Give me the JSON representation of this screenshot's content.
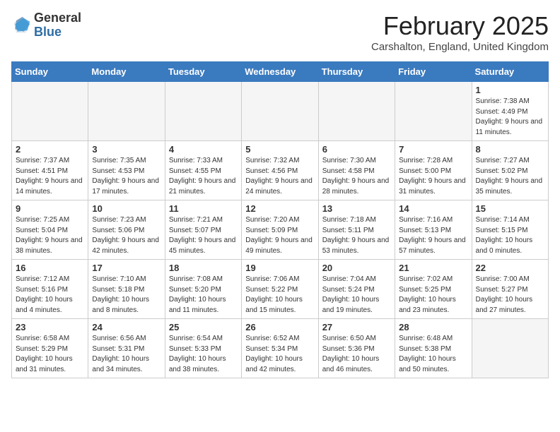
{
  "header": {
    "logo_general": "General",
    "logo_blue": "Blue",
    "month": "February 2025",
    "location": "Carshalton, England, United Kingdom"
  },
  "days_of_week": [
    "Sunday",
    "Monday",
    "Tuesday",
    "Wednesday",
    "Thursday",
    "Friday",
    "Saturday"
  ],
  "weeks": [
    [
      {
        "num": "",
        "info": ""
      },
      {
        "num": "",
        "info": ""
      },
      {
        "num": "",
        "info": ""
      },
      {
        "num": "",
        "info": ""
      },
      {
        "num": "",
        "info": ""
      },
      {
        "num": "",
        "info": ""
      },
      {
        "num": "1",
        "info": "Sunrise: 7:38 AM\nSunset: 4:49 PM\nDaylight: 9 hours and 11 minutes."
      }
    ],
    [
      {
        "num": "2",
        "info": "Sunrise: 7:37 AM\nSunset: 4:51 PM\nDaylight: 9 hours and 14 minutes."
      },
      {
        "num": "3",
        "info": "Sunrise: 7:35 AM\nSunset: 4:53 PM\nDaylight: 9 hours and 17 minutes."
      },
      {
        "num": "4",
        "info": "Sunrise: 7:33 AM\nSunset: 4:55 PM\nDaylight: 9 hours and 21 minutes."
      },
      {
        "num": "5",
        "info": "Sunrise: 7:32 AM\nSunset: 4:56 PM\nDaylight: 9 hours and 24 minutes."
      },
      {
        "num": "6",
        "info": "Sunrise: 7:30 AM\nSunset: 4:58 PM\nDaylight: 9 hours and 28 minutes."
      },
      {
        "num": "7",
        "info": "Sunrise: 7:28 AM\nSunset: 5:00 PM\nDaylight: 9 hours and 31 minutes."
      },
      {
        "num": "8",
        "info": "Sunrise: 7:27 AM\nSunset: 5:02 PM\nDaylight: 9 hours and 35 minutes."
      }
    ],
    [
      {
        "num": "9",
        "info": "Sunrise: 7:25 AM\nSunset: 5:04 PM\nDaylight: 9 hours and 38 minutes."
      },
      {
        "num": "10",
        "info": "Sunrise: 7:23 AM\nSunset: 5:06 PM\nDaylight: 9 hours and 42 minutes."
      },
      {
        "num": "11",
        "info": "Sunrise: 7:21 AM\nSunset: 5:07 PM\nDaylight: 9 hours and 45 minutes."
      },
      {
        "num": "12",
        "info": "Sunrise: 7:20 AM\nSunset: 5:09 PM\nDaylight: 9 hours and 49 minutes."
      },
      {
        "num": "13",
        "info": "Sunrise: 7:18 AM\nSunset: 5:11 PM\nDaylight: 9 hours and 53 minutes."
      },
      {
        "num": "14",
        "info": "Sunrise: 7:16 AM\nSunset: 5:13 PM\nDaylight: 9 hours and 57 minutes."
      },
      {
        "num": "15",
        "info": "Sunrise: 7:14 AM\nSunset: 5:15 PM\nDaylight: 10 hours and 0 minutes."
      }
    ],
    [
      {
        "num": "16",
        "info": "Sunrise: 7:12 AM\nSunset: 5:16 PM\nDaylight: 10 hours and 4 minutes."
      },
      {
        "num": "17",
        "info": "Sunrise: 7:10 AM\nSunset: 5:18 PM\nDaylight: 10 hours and 8 minutes."
      },
      {
        "num": "18",
        "info": "Sunrise: 7:08 AM\nSunset: 5:20 PM\nDaylight: 10 hours and 11 minutes."
      },
      {
        "num": "19",
        "info": "Sunrise: 7:06 AM\nSunset: 5:22 PM\nDaylight: 10 hours and 15 minutes."
      },
      {
        "num": "20",
        "info": "Sunrise: 7:04 AM\nSunset: 5:24 PM\nDaylight: 10 hours and 19 minutes."
      },
      {
        "num": "21",
        "info": "Sunrise: 7:02 AM\nSunset: 5:25 PM\nDaylight: 10 hours and 23 minutes."
      },
      {
        "num": "22",
        "info": "Sunrise: 7:00 AM\nSunset: 5:27 PM\nDaylight: 10 hours and 27 minutes."
      }
    ],
    [
      {
        "num": "23",
        "info": "Sunrise: 6:58 AM\nSunset: 5:29 PM\nDaylight: 10 hours and 31 minutes."
      },
      {
        "num": "24",
        "info": "Sunrise: 6:56 AM\nSunset: 5:31 PM\nDaylight: 10 hours and 34 minutes."
      },
      {
        "num": "25",
        "info": "Sunrise: 6:54 AM\nSunset: 5:33 PM\nDaylight: 10 hours and 38 minutes."
      },
      {
        "num": "26",
        "info": "Sunrise: 6:52 AM\nSunset: 5:34 PM\nDaylight: 10 hours and 42 minutes."
      },
      {
        "num": "27",
        "info": "Sunrise: 6:50 AM\nSunset: 5:36 PM\nDaylight: 10 hours and 46 minutes."
      },
      {
        "num": "28",
        "info": "Sunrise: 6:48 AM\nSunset: 5:38 PM\nDaylight: 10 hours and 50 minutes."
      },
      {
        "num": "",
        "info": ""
      }
    ]
  ]
}
